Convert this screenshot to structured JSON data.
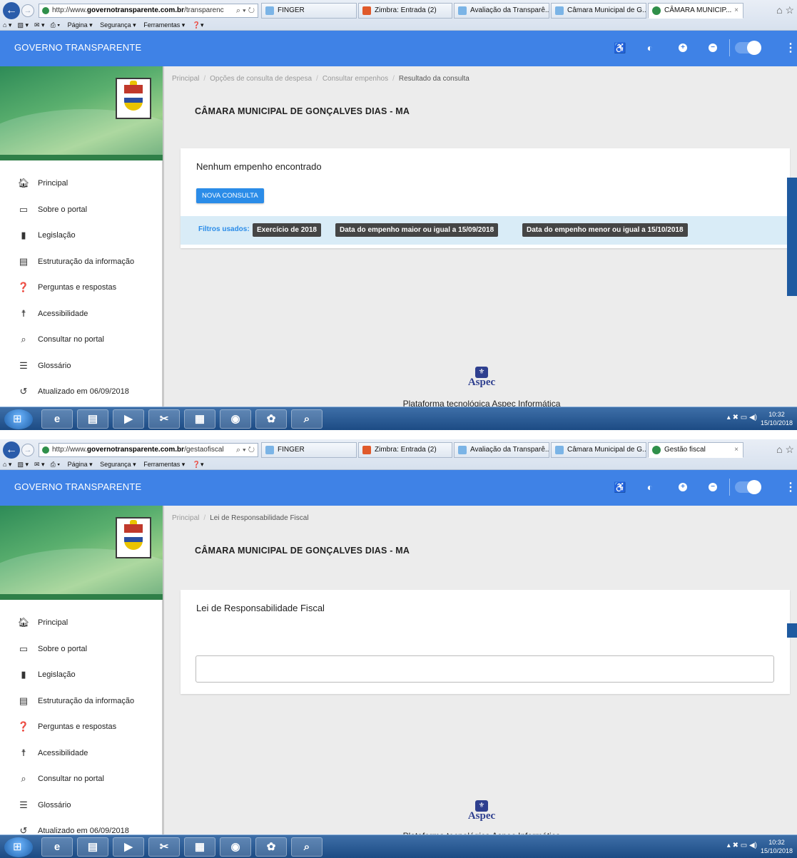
{
  "colors": {
    "header_blue": "#3f82e6",
    "button_blue": "#2b8ce8",
    "chip_dark": "#454545",
    "filter_bg": "#d9ecf7"
  },
  "shots": [
    {
      "browser": {
        "url_prefix": "http://www.",
        "url_host": "governotransparente.com.br",
        "url_path": "/transparenc",
        "tabs": [
          "FINGER",
          "Zimbra: Entrada (2)",
          "Avaliação da Transparê...",
          "Câmara Municipal de G...",
          "CÂMARA MUNICIP..."
        ],
        "menu": [
          "Página ▾",
          "Segurança ▾",
          "Ferramentas ▾"
        ]
      },
      "app": {
        "title": "GOVERNO TRANSPARENTE"
      },
      "sidebar": {
        "items": [
          "Principal",
          "Sobre o portal",
          "Legislação",
          "Estruturação da informação",
          "Perguntas e respostas",
          "Acessibilidade",
          "Consultar no portal",
          "Glossário",
          "Atualizado em 06/09/2018"
        ]
      },
      "breadcrumb": [
        "Principal",
        "Opções de consulta de despesa",
        "Consultar empenhos",
        "Resultado da consulta"
      ],
      "page_title": "CÂMARA MUNICIPAL DE GONÇALVES DIAS - MA",
      "card": {
        "title": "Nenhum empenho encontrado",
        "button": "NOVA CONSULTA",
        "filters_label": "Filtros usados:",
        "chips": [
          "Exercício de 2018",
          "Data do empenho maior ou igual a 15/09/2018",
          "Data do empenho menor ou igual a 15/10/2018"
        ]
      },
      "footer": {
        "brand": "Aspec",
        "text": "Plataforma tecnológica Aspec Informática"
      },
      "taskbar": {
        "time": "10:32",
        "date": "15/10/2018"
      }
    },
    {
      "browser": {
        "url_prefix": "http://www.",
        "url_host": "governotransparente.com.br",
        "url_path": "/gestaofiscal",
        "tabs": [
          "FINGER",
          "Zimbra: Entrada (2)",
          "Avaliação da Transparê...",
          "Câmara Municipal de G...",
          "Gestão fiscal"
        ],
        "menu": [
          "Página ▾",
          "Segurança ▾",
          "Ferramentas ▾"
        ]
      },
      "app": {
        "title": "GOVERNO TRANSPARENTE"
      },
      "sidebar": {
        "items": [
          "Principal",
          "Sobre o portal",
          "Legislação",
          "Estruturação da informação",
          "Perguntas e respostas",
          "Acessibilidade",
          "Consultar no portal",
          "Glossário",
          "Atualizado em 06/09/2018"
        ]
      },
      "breadcrumb": [
        "Principal",
        "Lei de Responsabilidade Fiscal"
      ],
      "page_title": "CÂMARA MUNICIPAL DE GONÇALVES DIAS - MA",
      "card": {
        "title": "Lei de Responsabilidade Fiscal"
      },
      "footer": {
        "brand": "Aspec",
        "text": "Plataforma tecnológica Aspec Informática"
      },
      "taskbar": {
        "time": "10:32",
        "date": "15/10/2018"
      }
    }
  ]
}
